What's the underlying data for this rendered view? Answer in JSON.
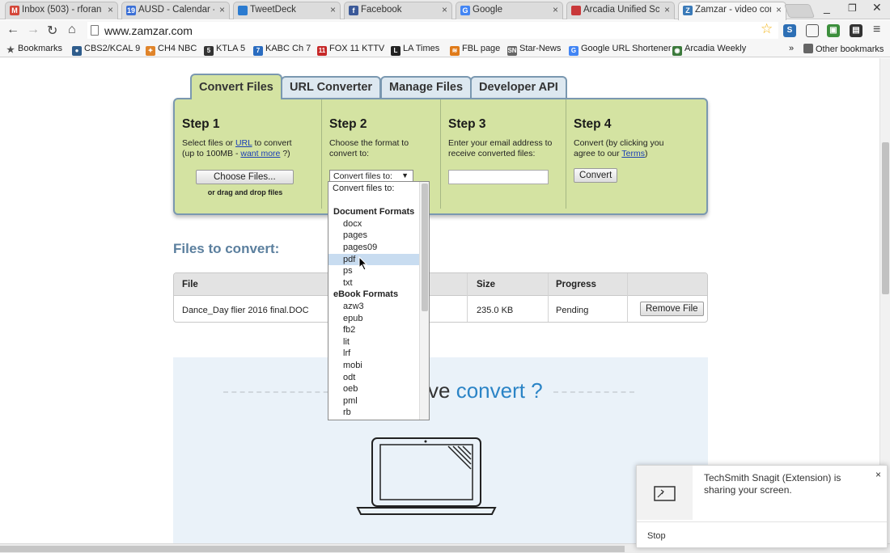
{
  "browser": {
    "tabs": [
      {
        "label": "Inbox (503) - rforan",
        "icon": "gmail-icon",
        "color": "#d44638",
        "glyph": "M"
      },
      {
        "label": "AUSD - Calendar - M",
        "icon": "calendar-icon",
        "color": "#3a6fd6",
        "glyph": "19"
      },
      {
        "label": "TweetDeck",
        "icon": "tweetdeck-icon",
        "color": "#2b7bd0",
        "glyph": ""
      },
      {
        "label": "Facebook",
        "icon": "facebook-icon",
        "color": "#3b5998",
        "glyph": "f"
      },
      {
        "label": "Google",
        "icon": "google-icon",
        "color": "#4285f4",
        "glyph": "G"
      },
      {
        "label": "Arcadia Unified Sch",
        "icon": "arcadia-icon",
        "color": "#c9383a",
        "glyph": ""
      },
      {
        "label": "Zamzar - video con",
        "icon": "zamzar-icon",
        "color": "#3a7ab8",
        "glyph": "Z",
        "active": true
      }
    ],
    "url": "www.zamzar.com",
    "bookmarks": [
      {
        "label": "Bookmarks",
        "icon": "star-icon",
        "color": "#555",
        "glyph": "★"
      },
      {
        "label": "CBS2/KCAL 9",
        "icon": "cbs-icon",
        "color": "#2f5d8c",
        "glyph": "●"
      },
      {
        "label": "CH4 NBC",
        "icon": "nbc-icon",
        "color": "#e0842a",
        "glyph": "✦"
      },
      {
        "label": "KTLA 5",
        "icon": "ktla-icon",
        "color": "#333",
        "glyph": "5"
      },
      {
        "label": "KABC Ch 7",
        "icon": "kabc-icon",
        "color": "#2a6cc0",
        "glyph": "7"
      },
      {
        "label": "FOX 11 KTTV",
        "icon": "fox-icon",
        "color": "#c62828",
        "glyph": "11"
      },
      {
        "label": "LA Times",
        "icon": "latimes-icon",
        "color": "#222",
        "glyph": "L"
      },
      {
        "label": "FBL page",
        "icon": "fbl-icon",
        "color": "#e07b1a",
        "glyph": "≋"
      },
      {
        "label": "Star-News",
        "icon": "starnews-icon",
        "color": "#666",
        "glyph": "SN"
      },
      {
        "label": "Google URL Shortener",
        "icon": "google-icon",
        "color": "#4285f4",
        "glyph": "G"
      },
      {
        "label": "Arcadia Weekly",
        "icon": "arcadia-weekly-icon",
        "color": "#3c7a3c",
        "glyph": "◉"
      }
    ],
    "more_bookmarks": "»",
    "other_bookmarks": "Other bookmarks"
  },
  "zamzar": {
    "tabs": [
      "Convert Files",
      "URL Converter",
      "Manage Files",
      "Developer API"
    ],
    "steps": {
      "step1": {
        "title": "Step 1",
        "text_a": "Select files or ",
        "link_url": "URL",
        "text_b": " to convert",
        "text_c": "(up to 100MB - ",
        "link_more": "want more",
        "text_d": " ?)",
        "button": "Choose Files...",
        "note": "or drag and drop files"
      },
      "step2": {
        "title": "Step 2",
        "text": "Choose the format to convert to:",
        "select_value": "Convert files to:"
      },
      "step3": {
        "title": "Step 3",
        "text": "Enter your email address to receive converted files:"
      },
      "step4": {
        "title": "Step 4",
        "text_a": "Convert (by clicking you agree to our ",
        "link_terms": "Terms",
        "text_b": ")",
        "button": "Convert"
      }
    },
    "files": {
      "title": "Files to convert:",
      "columns": [
        "File",
        "Size",
        "Progress"
      ],
      "rows": [
        {
          "file": "Dance_Day flier 2016 final.DOC",
          "size": "235.0 KB",
          "progress": "Pending",
          "action": "Remove File"
        }
      ]
    },
    "promo": {
      "title_hidden": "ve",
      "title_highlight": "convert ?"
    },
    "dropdown": {
      "items": [
        {
          "label": "Convert files to:",
          "kind": "first"
        },
        {
          "label": "",
          "kind": "blank"
        },
        {
          "label": "Document Formats",
          "kind": "group"
        },
        {
          "label": "docx",
          "kind": "opt"
        },
        {
          "label": "pages",
          "kind": "opt"
        },
        {
          "label": "pages09",
          "kind": "opt"
        },
        {
          "label": "pdf",
          "kind": "opt",
          "selected": true
        },
        {
          "label": "ps",
          "kind": "opt"
        },
        {
          "label": "txt",
          "kind": "opt"
        },
        {
          "label": "eBook Formats",
          "kind": "group"
        },
        {
          "label": "azw3",
          "kind": "opt"
        },
        {
          "label": "epub",
          "kind": "opt"
        },
        {
          "label": "fb2",
          "kind": "opt"
        },
        {
          "label": "lit",
          "kind": "opt"
        },
        {
          "label": "lrf",
          "kind": "opt"
        },
        {
          "label": "mobi",
          "kind": "opt"
        },
        {
          "label": "odt",
          "kind": "opt"
        },
        {
          "label": "oeb",
          "kind": "opt"
        },
        {
          "label": "pml",
          "kind": "opt"
        },
        {
          "label": "rb",
          "kind": "opt"
        }
      ]
    }
  },
  "notification": {
    "message": "TechSmith Snagit (Extension) is sharing your screen.",
    "stop": "Stop",
    "close": "×"
  }
}
